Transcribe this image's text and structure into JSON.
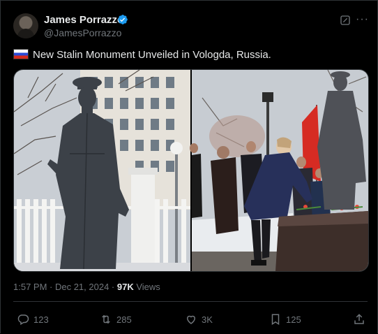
{
  "author": {
    "name": "James Porrazzo",
    "handle": "@JamesPorrazzo",
    "verified": true
  },
  "tweet": {
    "flag_icon": "russia-flag-icon",
    "text": "New Stalin Monument Unveiled in Vologda, Russia."
  },
  "meta": {
    "time": "1:57 PM · Dec 21, 2024 · ",
    "views_count": "97K",
    "views_label": " Views"
  },
  "actions": {
    "replies": "123",
    "reposts": "285",
    "likes": "3K",
    "bookmarks": "125"
  },
  "colors": {
    "background": "#000000",
    "text_primary": "#e7e9ea",
    "text_secondary": "#71767b",
    "verified_blue": "#1d9bf0"
  }
}
